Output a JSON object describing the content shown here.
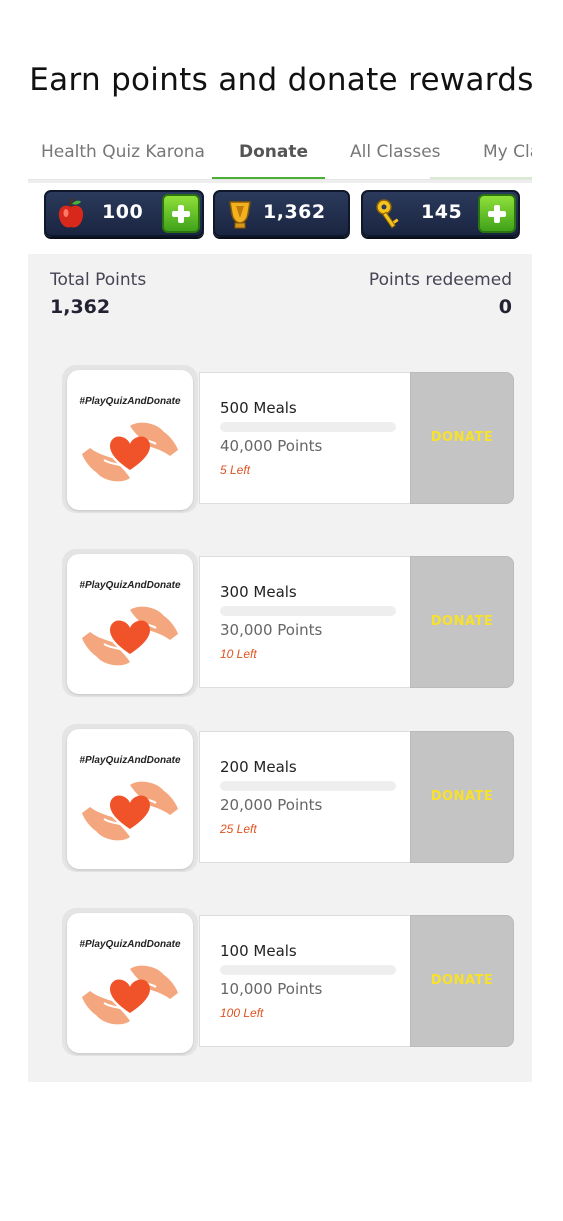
{
  "headline": "Earn points and donate rewards",
  "tabs": [
    {
      "label": "Health Quiz Karona",
      "active": false
    },
    {
      "label": "Donate",
      "active": true
    },
    {
      "label": "All Classes",
      "active": false
    },
    {
      "label": "My Cla",
      "active": false
    }
  ],
  "currencies": [
    {
      "icon": "apple-icon",
      "value": "100",
      "has_plus": true
    },
    {
      "icon": "trophy-icon",
      "value": "1,362",
      "has_plus": false
    },
    {
      "icon": "key-icon",
      "value": "145",
      "has_plus": true
    }
  ],
  "stats": {
    "total_label": "Total Points",
    "total_value": "1,362",
    "redeemed_label": "Points redeemed",
    "redeemed_value": "0"
  },
  "rewards": [
    {
      "hashtag": "#PlayQuizAndDonate",
      "meals": "500 Meals",
      "points": "40,000 Points",
      "left": "5 Left",
      "button": "DONATE",
      "progress": 0
    },
    {
      "hashtag": "#PlayQuizAndDonate",
      "meals": "300 Meals",
      "points": "30,000 Points",
      "left": "10 Left",
      "button": "DONATE",
      "progress": 0
    },
    {
      "hashtag": "#PlayQuizAndDonate",
      "meals": "200 Meals",
      "points": "20,000 Points",
      "left": "25 Left",
      "button": "DONATE",
      "progress": 0
    },
    {
      "hashtag": "#PlayQuizAndDonate",
      "meals": "100 Meals",
      "points": "10,000 Points",
      "left": "100 Left",
      "button": "DONATE",
      "progress": 0
    }
  ],
  "colors": {
    "tab_accent": "#4caf35",
    "donate_text": "#f7e12a",
    "left_text": "#e0521f",
    "heart": "#f0532a",
    "hands": "#f4a77e"
  }
}
